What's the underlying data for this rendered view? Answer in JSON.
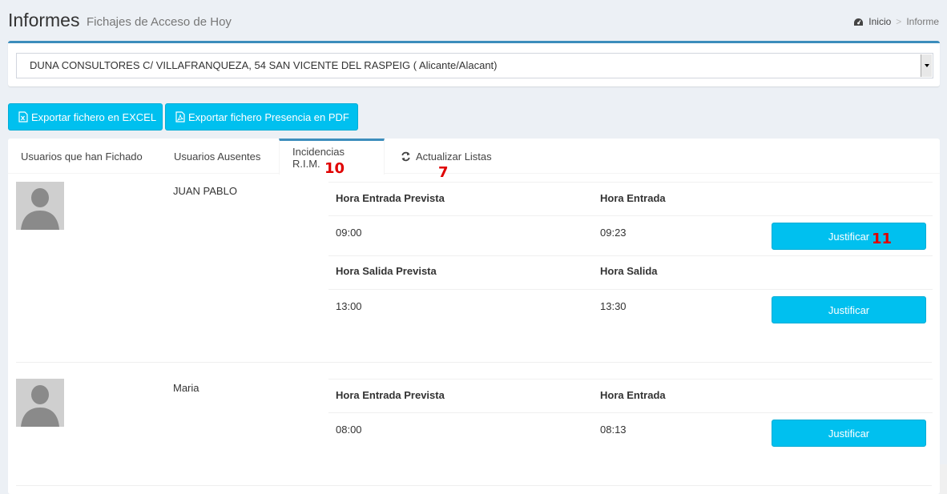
{
  "header": {
    "title": "Informes",
    "subtitle": "Fichajes de Acceso de Hoy",
    "breadcrumb": {
      "home": "Inicio",
      "separator": ">",
      "current": "Informe"
    }
  },
  "company_select": {
    "value": "DUNA CONSULTORES C/ VILLAFRANQUEZA, 54 SAN VICENTE DEL RASPEIG ( Alicante/Alacant)"
  },
  "export": {
    "excel_label": "Exportar fichero en EXCEL",
    "pdf_label": "Exportar fichero Presencia en PDF"
  },
  "tabs": [
    {
      "label": "Usuarios que han Fichado",
      "active": false
    },
    {
      "label": "Usuarios Ausentes",
      "active": false
    },
    {
      "label": "Incidencias R.I.M.",
      "active": true
    },
    {
      "label": "Actualizar Listas",
      "icon": "refresh-icon"
    }
  ],
  "markers": {
    "tab_rim": "10",
    "tab_refresh": "7",
    "justify_first": "11"
  },
  "users": [
    {
      "name": "JUAN PABLO",
      "incidents": [
        {
          "planned_label": "Hora Entrada Prevista",
          "actual_label": "Hora Entrada",
          "planned": "09:00",
          "actual": "09:23",
          "action": "Justificar"
        },
        {
          "planned_label": "Hora Salida Prevista",
          "actual_label": "Hora Salida",
          "planned": "13:00",
          "actual": "13:30",
          "action": "Justificar"
        }
      ]
    },
    {
      "name": "Maria",
      "incidents": [
        {
          "planned_label": "Hora Entrada Prevista",
          "actual_label": "Hora Entrada",
          "planned": "08:00",
          "actual": "08:13",
          "action": "Justificar"
        }
      ]
    }
  ],
  "colors": {
    "accent": "#00c0ef",
    "tab_border": "#3c8dbc",
    "marker": "#e00000",
    "background": "#ecf0f5"
  }
}
